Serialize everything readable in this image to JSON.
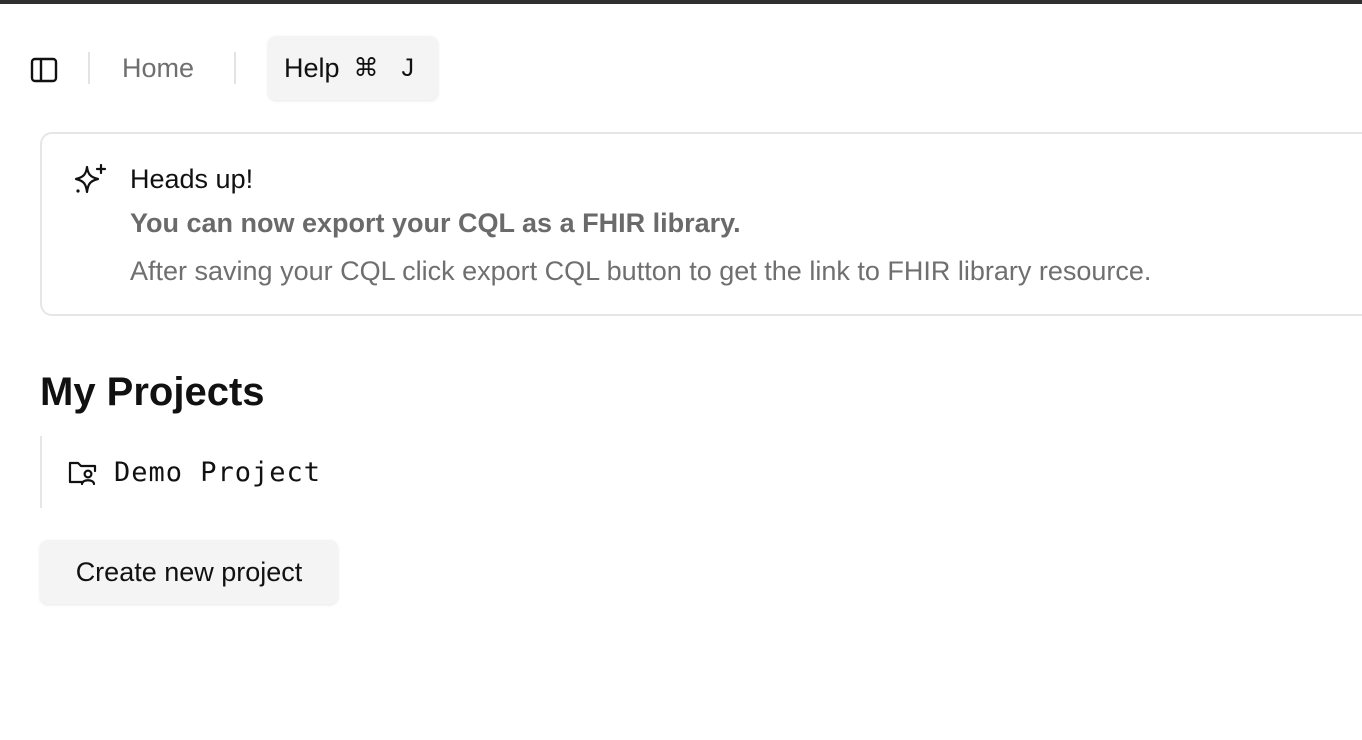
{
  "header": {
    "sidebar_toggle_icon": "sidebar-panel-icon",
    "home_label": "Home",
    "help_label": "Help",
    "help_shortcut": "⌘ J"
  },
  "alert": {
    "icon": "sparkles-icon",
    "title": "Heads up!",
    "headline": "You can now export your CQL as a FHIR library.",
    "description": "After saving your CQL click export CQL button to get the link to FHIR library resource."
  },
  "projects": {
    "title": "My Projects",
    "items": [
      {
        "name": "Demo Project",
        "icon": "folder-user-icon"
      }
    ],
    "create_label": "Create new project"
  },
  "colors": {
    "top_rule": "#2f2f2f",
    "button_bg": "#f4f4f4",
    "muted_text": "#6f6f6f",
    "border": "#e6e6e6"
  }
}
